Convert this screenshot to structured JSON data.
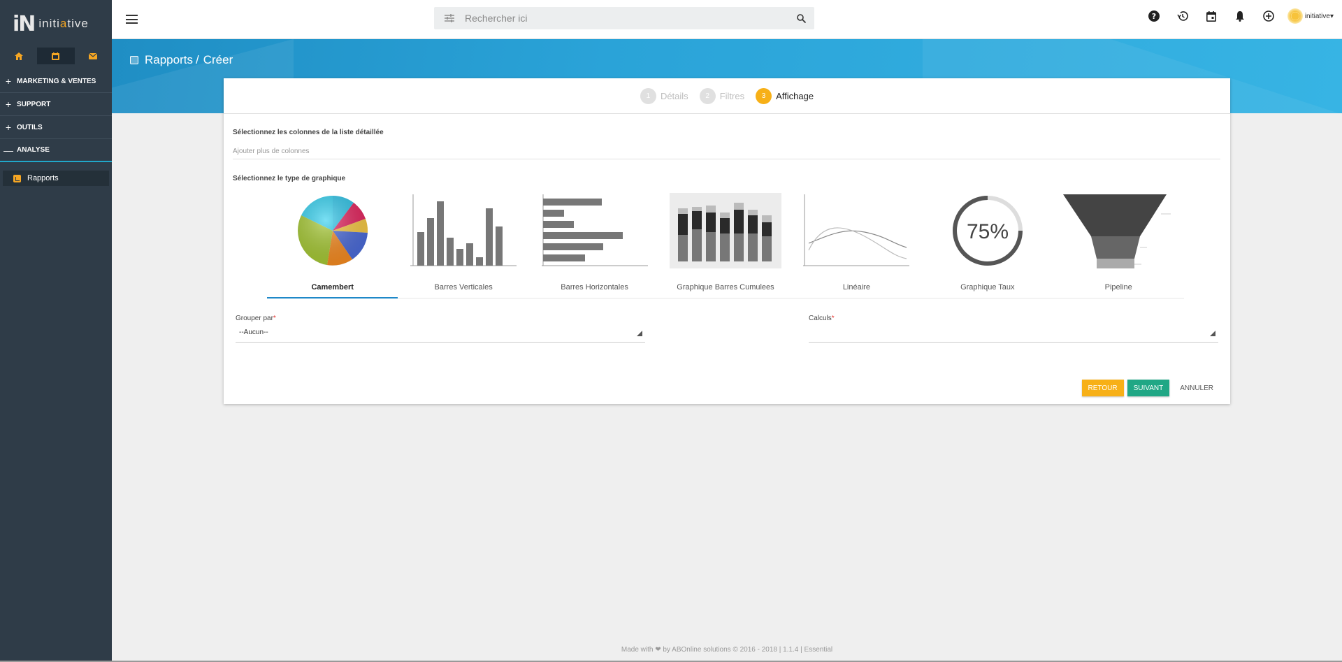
{
  "app": {
    "logo_mark": "iN",
    "logo_text_start": "initi",
    "logo_text_accent": "a",
    "logo_text_end": "tive"
  },
  "sidebar": {
    "quick_icons": [
      "home-icon",
      "calendar-icon",
      "mail-icon"
    ],
    "groups": [
      {
        "sign": "+",
        "label": "MARKETING & VENTES"
      },
      {
        "sign": "+",
        "label": "SUPPORT"
      },
      {
        "sign": "+",
        "label": "OUTILS"
      },
      {
        "sign": "—",
        "label": "ANALYSE"
      }
    ],
    "sub_items": [
      {
        "label": "Rapports"
      }
    ]
  },
  "topbar": {
    "search_placeholder": "Rechercher ici",
    "icons": [
      "help-icon",
      "history-icon",
      "calendar-icon",
      "bell-icon",
      "add-circle-icon"
    ],
    "user_name": "initiative",
    "user_caret": "▾"
  },
  "breadcrumb": {
    "parent": "Rapports",
    "separator": "/",
    "current": "Créer"
  },
  "steps": [
    {
      "num": "1",
      "label": "Détails",
      "active": false
    },
    {
      "num": "2",
      "label": "Filtres",
      "active": false
    },
    {
      "num": "3",
      "label": "Affichage",
      "active": true
    }
  ],
  "form": {
    "columns_label": "Sélectionnez les colonnes de la liste détaillée",
    "columns_placeholder": "Ajouter plus de colonnes",
    "chart_type_label": "Sélectionnez le type de graphique",
    "chart_types": [
      {
        "label": "Camembert",
        "selected": true
      },
      {
        "label": "Barres Verticales",
        "selected": false
      },
      {
        "label": "Barres Horizontales",
        "selected": false
      },
      {
        "label": "Graphique Barres Cumulees",
        "selected": false
      },
      {
        "label": "Linéaire",
        "selected": false
      },
      {
        "label": "Graphique Taux",
        "selected": false
      },
      {
        "label": "Pipeline",
        "selected": false
      }
    ],
    "rate_thumbnail_text": "75%",
    "group_by_label": "Grouper par",
    "group_by_value": "--Aucun--",
    "calculs_label": "Calculs",
    "calculs_value": "",
    "required_mark": "*"
  },
  "actions": {
    "back": "RETOUR",
    "next": "SUIVANT",
    "cancel": "ANNULER"
  },
  "footer": {
    "text": "Made with ❤ by ABOnline solutions © 2016 - 2018 | 1.1.4 | Essential"
  },
  "colors": {
    "sidebar_bg": "#2f3c48",
    "accent_orange": "#f7b017",
    "accent_green": "#20a785",
    "banner_blue": "#2aa3d8"
  }
}
